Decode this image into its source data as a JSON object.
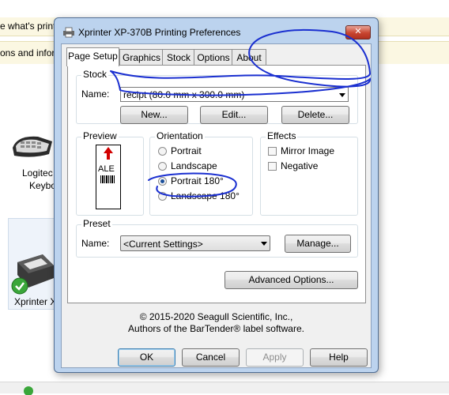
{
  "background": {
    "top_text": "e what's print",
    "info_text": "ons and inform",
    "device_keyboard_label_1": "Logitec",
    "device_keyboard_label_2": "Keybo",
    "device_printer_label": "Xprinter X"
  },
  "dialog": {
    "title": "Xprinter XP-370B Printing Preferences",
    "close_glyph": "✕",
    "tabs": [
      {
        "label": "Page Setup",
        "active": true
      },
      {
        "label": "Graphics",
        "active": false
      },
      {
        "label": "Stock",
        "active": false
      },
      {
        "label": "Options",
        "active": false
      },
      {
        "label": "About",
        "active": false
      }
    ],
    "stock": {
      "group_label": "Stock",
      "name_label": "Name:",
      "name_value": "recipt (80.0 mm x 300.0 mm)",
      "new_button": "New...",
      "edit_button": "Edit...",
      "delete_button": "Delete..."
    },
    "preview": {
      "group_label": "Preview",
      "sample_text": "ALE"
    },
    "orientation": {
      "group_label": "Orientation",
      "options": [
        {
          "label": "Portrait",
          "selected": false
        },
        {
          "label": "Landscape",
          "selected": false
        },
        {
          "label": "Portrait 180°",
          "selected": true
        },
        {
          "label": "Landscape 180°",
          "selected": false
        }
      ]
    },
    "effects": {
      "group_label": "Effects",
      "options": [
        {
          "label": "Mirror Image",
          "checked": false
        },
        {
          "label": "Negative",
          "checked": false
        }
      ]
    },
    "preset": {
      "group_label": "Preset",
      "name_label": "Name:",
      "name_value": "<Current Settings>",
      "manage_button": "Manage..."
    },
    "advanced_button": "Advanced Options...",
    "copyright_line1": "© 2015-2020 Seagull Scientific, Inc.,",
    "copyright_line2": "Authors of the BarTender® label software.",
    "footer": {
      "ok": "OK",
      "cancel": "Cancel",
      "apply": "Apply",
      "help": "Help"
    }
  },
  "colors": {
    "dialog_frame": "#bcd3ee",
    "annotation_ink": "#1a2fd0",
    "close_button": "#c8452f",
    "selected_radio": "#1a4f9b"
  }
}
